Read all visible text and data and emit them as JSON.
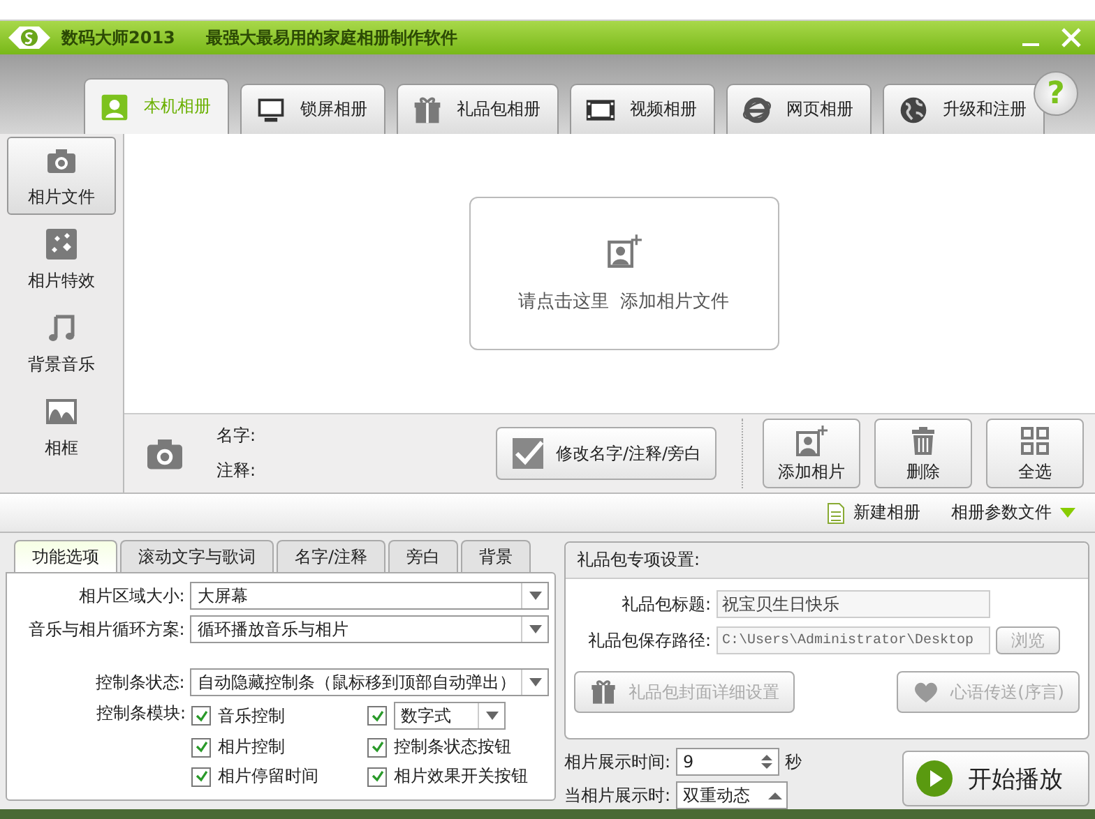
{
  "window": {
    "app_name": "数码大师2013",
    "slogan": "最强大最易用的家庭相册制作软件"
  },
  "tabs": [
    {
      "label": "本机相册",
      "kind": "person",
      "selected": true
    },
    {
      "label": "锁屏相册",
      "kind": "monitor",
      "selected": false
    },
    {
      "label": "礼品包相册",
      "kind": "gift",
      "selected": false
    },
    {
      "label": "视频相册",
      "kind": "film",
      "selected": false
    },
    {
      "label": "网页相册",
      "kind": "browser",
      "selected": false
    },
    {
      "label": "升级和注册",
      "kind": "globe",
      "selected": false
    }
  ],
  "help": {
    "label": "?"
  },
  "sidebar": {
    "items": [
      {
        "label": "相片文件",
        "kind": "camera",
        "selected": true
      },
      {
        "label": "相片特效",
        "kind": "sparkle",
        "selected": false
      },
      {
        "label": "背景音乐",
        "kind": "music",
        "selected": false
      },
      {
        "label": "相框",
        "kind": "frame",
        "selected": false
      }
    ]
  },
  "drop_area": {
    "text": "请点击这里  添加相片文件"
  },
  "info": {
    "name_label": "名字:",
    "note_label": "注释:",
    "edit_button": "修改名字/注释/旁白"
  },
  "photo_actions": [
    {
      "label": "添加相片",
      "kind": "add-photo"
    },
    {
      "label": "删除",
      "kind": "trash"
    },
    {
      "label": "全选",
      "kind": "grid"
    }
  ],
  "toolbar": {
    "new_album": "新建相册",
    "album_file": "相册参数文件"
  },
  "options_tabs": [
    {
      "label": "功能选项",
      "selected": true
    },
    {
      "label": "滚动文字与歌词",
      "selected": false
    },
    {
      "label": "名字/注释",
      "selected": false
    },
    {
      "label": "旁白",
      "selected": false
    },
    {
      "label": "背景",
      "selected": false
    }
  ],
  "options": {
    "selects": [
      {
        "label": "相片区域大小:",
        "value": "大屏幕"
      },
      {
        "label": "音乐与相片循环方案:",
        "value": "循环播放音乐与相片"
      },
      {
        "label": "控制条状态:",
        "value": "自动隐藏控制条（鼠标移到顶部自动弹出）"
      }
    ],
    "modules_label": "控制条模块:",
    "modules": [
      {
        "kind": "check",
        "label": "音乐控制",
        "checked": true
      },
      {
        "kind": "check-select",
        "value": "数字式",
        "checked": true
      },
      {
        "kind": "check",
        "label": "相片控制",
        "checked": true
      },
      {
        "kind": "check",
        "label": "控制条状态按钮",
        "checked": true
      },
      {
        "kind": "check",
        "label": "相片停留时间",
        "checked": true
      },
      {
        "kind": "check",
        "label": "相片效果开关按钮",
        "checked": true
      }
    ]
  },
  "gift": {
    "heading": "礼品包专项设置:",
    "title_label": "礼品包标题:",
    "title_value": "祝宝贝生日快乐",
    "path_label": "礼品包保存路径:",
    "path_value": "C:\\Users\\Administrator\\Desktop",
    "browse": {
      "label": "浏览",
      "disabled": true
    },
    "buttons": [
      {
        "label": "礼品包封面详细设置",
        "kind": "gift",
        "disabled": true
      },
      {
        "label": "心语传送(序言)",
        "kind": "heart",
        "disabled": true
      }
    ]
  },
  "display_time": {
    "label": "相片展示时间:",
    "value": "9",
    "unit": "秒"
  },
  "display_effect": {
    "label": "当相片展示时:",
    "value": "双重动态"
  },
  "play_button": {
    "label": "开始播放"
  }
}
